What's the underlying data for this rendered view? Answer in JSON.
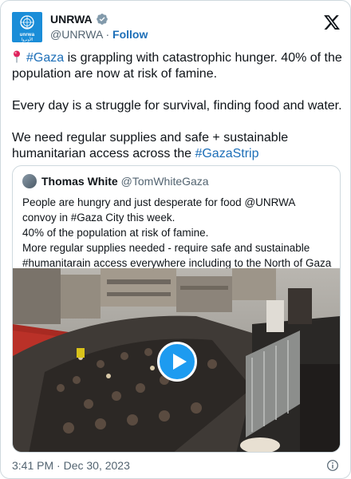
{
  "author": {
    "display_name": "UNRWA",
    "handle": "@UNRWA",
    "separator": "·",
    "follow_label": "Follow",
    "avatar_text": "unrwa",
    "avatar_text_ar": "الأونروا",
    "verified_color": "#829aab"
  },
  "tweet": {
    "pin_emoji": "📍",
    "p1_hashtag": "#Gaza",
    "p1_rest": " is grappling with catastrophic hunger. 40% of the population are now at risk of famine.",
    "p2": "Every day is a struggle for survival, finding food and water.",
    "p3_start": "We need regular supplies and safe + sustainable humanitarian access across the ",
    "p3_hashtag": "#GazaStrip"
  },
  "quote": {
    "display_name": "Thomas White",
    "handle": "@TomWhiteGaza",
    "line1": "People are hungry and just desperate for food @UNRWA convoy in #Gaza City this week.",
    "line2": "40% of the population at risk of famine.",
    "line3": "More regular supplies needed - require safe and sustainable #humanitarain access everywhere including to the North of Gaza"
  },
  "footer": {
    "timestamp": "3:41 PM · Dec 30, 2023"
  },
  "colors": {
    "link": "#1d6fb8",
    "play_button": "#1d9bf0",
    "muted_text": "#536471"
  }
}
